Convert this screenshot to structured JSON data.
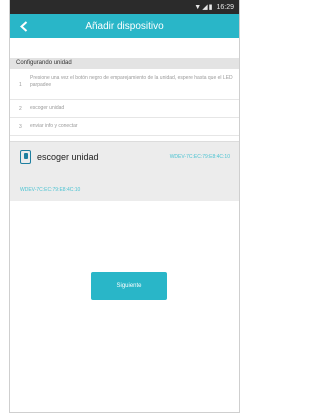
{
  "status_bar": {
    "icons": "signal wifi battery",
    "time": "16:29"
  },
  "app_bar": {
    "title": "Añadir dispositivo",
    "back_icon": "back-arrow-icon"
  },
  "section": {
    "header": "Configurando unidad"
  },
  "steps": [
    {
      "number": "1",
      "text": "Presione una vez el botón negro de emparejamiento de la unidad, espere hasta que el LED parpadee"
    },
    {
      "number": "2",
      "text": "escoger unidad"
    },
    {
      "number": "3",
      "text": "enviar info y conectar"
    }
  ],
  "selection": {
    "label": "escoger unidad",
    "value": "WDEV-7C:EC:79:E8:4C:10",
    "device_id": "WDEV-7C:EC:79:E8:4C:10"
  },
  "actions": {
    "next_label": "Siguiente"
  },
  "colors": {
    "accent": "#29b6c8",
    "accent_text": "#4bc3d2",
    "statusbar": "#2b2b2b"
  }
}
